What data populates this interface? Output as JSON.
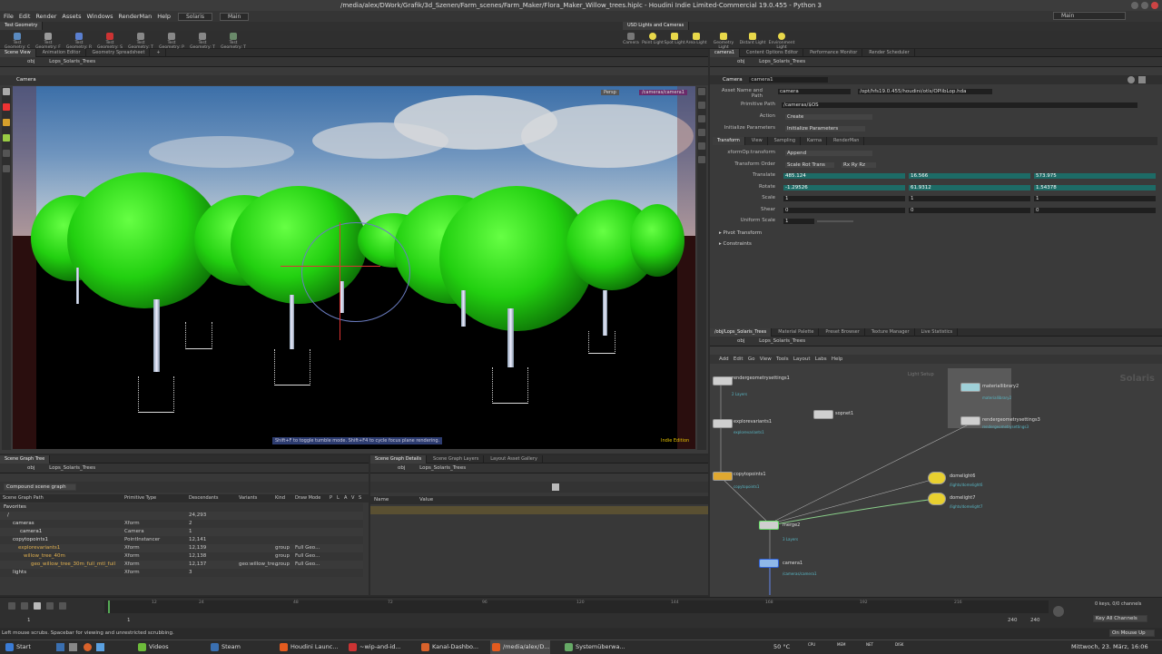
{
  "window": {
    "title": "/media/alex/DWork/Grafik/3d_Szenen/Farm_scenes/Farm_Maker/Flora_Maker_Willow_trees.hiplc - Houdini Indie Limited-Commercial 19.0.455 - Python 3"
  },
  "menubar": {
    "items": [
      "File",
      "Edit",
      "Render",
      "Assets",
      "Windows",
      "RenderMan",
      "Help"
    ],
    "desktop": "Solaris",
    "desktop_right": "Main",
    "context": "Main"
  },
  "shelf": {
    "left_tab": "Test Geometry",
    "right_tab": "USD Lights and Cameras",
    "left_tools": [
      "Test Geometry: C",
      "Test Geometry: F",
      "Test Geometry: R",
      "Test Geometry: S",
      "Test Geometry: T",
      "Test Geometry: P",
      "Test Geometry: T",
      "Test Geometry: T"
    ],
    "right_tools": [
      "Camera",
      "Point Light",
      "Spot Light",
      "Area Light",
      "Geometry Light",
      "Distant Light",
      "Environment Light"
    ]
  },
  "left_tabs": [
    "Scene View",
    "Animation Editor",
    "Geometry Spreadsheet"
  ],
  "viewer": {
    "path": "Lops_Solaris_Trees",
    "root": "obj",
    "camera": "Camera",
    "persp": "Persp",
    "cam_name": "/cameras/camera1",
    "hint": "Shift+F to toggle tumble mode. Shift+F4 to cycle focus plane rendering.",
    "edition": "Indie Edition"
  },
  "right_tabs": [
    "camera1",
    "Content Options Editor",
    "Performance Monitor",
    "Render Scheduler"
  ],
  "params": {
    "path": "Lops_Solaris_Trees",
    "root": "obj",
    "node_type": "Camera",
    "node_name": "camera1",
    "asset_label": "Asset Name and Path",
    "asset_name": "camera",
    "asset_path": "/opt/hfs19.0.455/houdini/otls/OPlibLop.hda",
    "prim_label": "Primitive Path",
    "prim_value": "/cameras/$OS",
    "action_label": "Action",
    "action_value": "Create",
    "init_label": "Initialize Parameters",
    "init_value": "Initialize Parameters",
    "tabs": [
      "Transform",
      "View",
      "Sampling",
      "Karma",
      "RenderMan"
    ],
    "xform_label": "xformOp:transform",
    "xform_value": "Append",
    "order_label": "Transform Order",
    "order_value": "Scale Rot Trans",
    "rot_order": "Rx Ry Rz",
    "translate_label": "Translate",
    "translate": [
      "485.124",
      "16.566",
      "573.975"
    ],
    "rotate_label": "Rotate",
    "rotate": [
      "-1.29526",
      "61.9312",
      "1.54378"
    ],
    "scale_label": "Scale",
    "scale": [
      "1",
      "1",
      "1"
    ],
    "shear_label": "Shear",
    "shear": [
      "0",
      "0",
      "0"
    ],
    "uscale_label": "Uniform Scale",
    "uscale": "1",
    "pivot": "Pivot Transform",
    "constraints": "Constraints"
  },
  "network": {
    "tabs": [
      "/obj/Lops_Solaris_Trees",
      "Material Palette",
      "Preset Browser",
      "Texture Manager",
      "Live Statistics"
    ],
    "path": "Lops_Solaris_Trees",
    "root": "obj",
    "menu": [
      "Add",
      "Edit",
      "Go",
      "View",
      "Tools",
      "Layout",
      "Labs",
      "Help"
    ],
    "context": "Solaris",
    "box_label": "Light Setup",
    "nodes": [
      {
        "name": "rendergeometrysettings1",
        "sub": "2 Layers"
      },
      {
        "name": "explorevariants1",
        "sub": "explorevariants1"
      },
      {
        "name": "copytopoints1",
        "sub": "copytopoints1"
      },
      {
        "name": "sopnet1",
        "sub": ""
      },
      {
        "name": "materiallibrary2",
        "sub": "materiallibrary2"
      },
      {
        "name": "rendergeometrysettings3",
        "sub": "rendergeometrysettings3"
      },
      {
        "name": "domelight6",
        "sub": "/lights/domelight6"
      },
      {
        "name": "domelight7",
        "sub": "/lights/domelight7"
      },
      {
        "name": "merge2",
        "sub": "3 Layers"
      },
      {
        "name": "camera1",
        "sub": "/cameras/camera1"
      }
    ]
  },
  "sgtree": {
    "tabs": [
      "Scene Graph Tree"
    ],
    "path": "Lops_Solaris_Trees",
    "root": "obj",
    "mode": "Compound scene graph",
    "columns": [
      "Scene Graph Path",
      "Primitive Type",
      "Descendants",
      "Variants",
      "Kind",
      "Draw Mode",
      "P",
      "L",
      "A",
      "V",
      "S"
    ],
    "rows": [
      {
        "path": "Favorites",
        "type": "",
        "desc": "",
        "var": "",
        "kind": "",
        "draw": ""
      },
      {
        "path": "/",
        "type": "",
        "desc": "24,293",
        "var": "",
        "kind": "",
        "draw": ""
      },
      {
        "path": "cameras",
        "type": "Xform",
        "desc": "2",
        "var": "",
        "kind": "",
        "draw": ""
      },
      {
        "path": "camera1",
        "type": "Camera",
        "desc": "1",
        "var": "",
        "kind": "",
        "draw": ""
      },
      {
        "path": "copytopoints1",
        "type": "PointInstancer",
        "desc": "12,141",
        "var": "",
        "kind": "",
        "draw": ""
      },
      {
        "path": "explorevariants1",
        "type": "Xform",
        "desc": "12,139",
        "var": "",
        "kind": "group",
        "draw": "Full Geo..."
      },
      {
        "path": "willow_tree_40m",
        "type": "Xform",
        "desc": "12,138",
        "var": "",
        "kind": "group",
        "draw": "Full Geo..."
      },
      {
        "path": "geo_willow_tree_30m_full_mtl_fuil",
        "type": "Xform",
        "desc": "12,137",
        "var": "geo:willow_tre...",
        "kind": "group",
        "draw": "Full Geo..."
      },
      {
        "path": "lights",
        "type": "Xform",
        "desc": "3",
        "var": "",
        "kind": "",
        "draw": ""
      }
    ]
  },
  "sgdetails": {
    "tabs": [
      "Scene Graph Details",
      "Scene Graph Layers",
      "Layout Asset Gallery"
    ],
    "path": "Lops_Solaris_Trees",
    "root": "obj",
    "columns": [
      "Name",
      "Value"
    ]
  },
  "timeline": {
    "frame": "4",
    "start": "1",
    "start2": "1",
    "end": "240",
    "end2": "240",
    "ticks": [
      "12",
      "24",
      "48",
      "72",
      "96",
      "120",
      "144",
      "168",
      "192",
      "216"
    ],
    "keys": "0 keys, 0/0 channels",
    "key_all": "Key All Channels",
    "auto_update": "On Mouse Up"
  },
  "status": "Left mouse scrubs. Spacebar for viewing and unrestricted scrubbing.",
  "taskbar": {
    "start": "Start",
    "items": [
      "Videos",
      "Steam",
      "Houdini Launc...",
      "~wip-and-id...",
      "Kanal-Dashbo...",
      "/media/alex/D...",
      "Systemüberwa..."
    ],
    "temp": "50 °C",
    "meters": [
      "CPU",
      "MEM",
      "NET",
      "DISK"
    ],
    "clock": "Mittwoch, 23. März, 16:06"
  }
}
